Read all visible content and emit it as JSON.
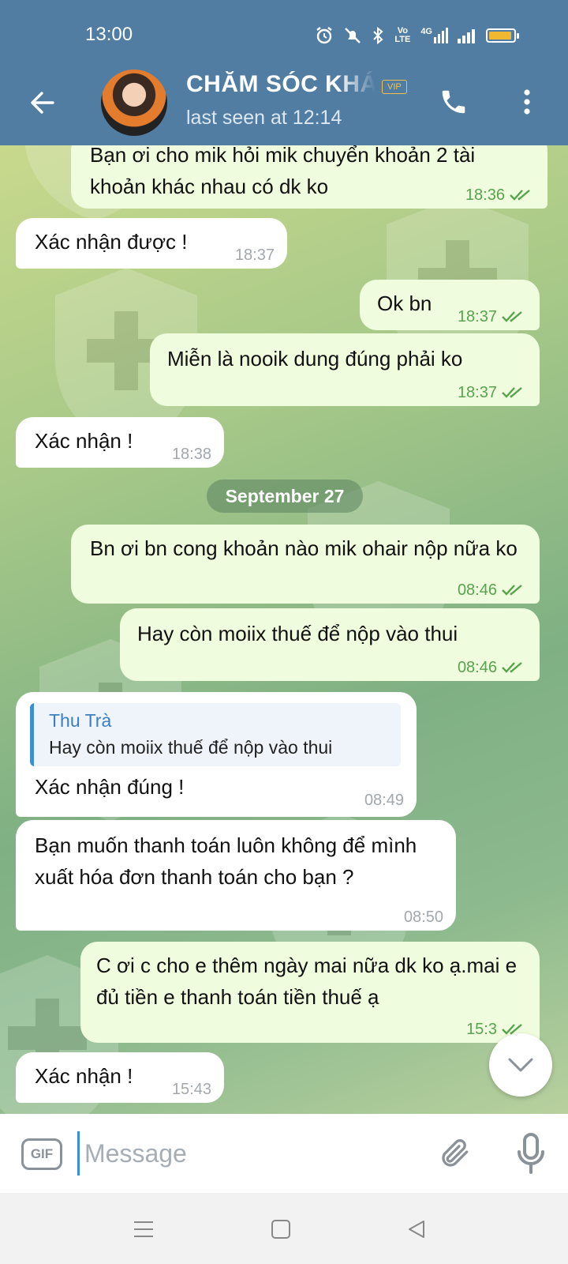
{
  "status_bar": {
    "time": "13:00",
    "volte": "Vo LTE",
    "network": "4G"
  },
  "header": {
    "title": "CHĂM SÓC KHÁCH HÀNG",
    "badge": "VIP",
    "subtitle": "last seen at 12:14"
  },
  "messages": [
    {
      "direction": "out",
      "text": "Bạn ơi cho mik hỏi mik chuyển khoản 2 tài khoản khác nhau có dk ko",
      "time": "18:36",
      "read": true
    },
    {
      "direction": "in",
      "text": "Xác nhận được !",
      "time": "18:37"
    },
    {
      "direction": "out",
      "text": "Ok bn",
      "time": "18:37",
      "read": true
    },
    {
      "direction": "out",
      "text": "Miễn là nooik dung đúng phải ko",
      "time": "18:37",
      "read": true
    },
    {
      "direction": "in",
      "text": "Xác nhận !",
      "time": "18:38"
    },
    {
      "direction": "out",
      "text": "Bn ơi bn cong khoản nào mik ohair nộp nữa ko",
      "time": "08:46",
      "read": true
    },
    {
      "direction": "out",
      "text": "Hay còn moiix thuế để nộp vào thui",
      "time": "08:46",
      "read": true
    },
    {
      "direction": "in",
      "text": "Xác nhận đúng !",
      "time": "08:49",
      "reply_to": {
        "name": "Thu Trà",
        "text": "Hay còn moiix thuế để nộp vào thui"
      }
    },
    {
      "direction": "in",
      "text": "Bạn muốn thanh toán luôn không để mình xuất hóa đơn thanh toán cho bạn ?",
      "time": "08:50"
    },
    {
      "direction": "out",
      "text": "C ơi c cho e thêm ngày mai nữa dk ko ạ.mai e đủ tiền e thanh toán tiền thuế ạ",
      "time": "15:3",
      "read": true
    },
    {
      "direction": "in",
      "text": "Xác nhận !",
      "time": "15:43"
    }
  ],
  "date_divider": "September 27",
  "input": {
    "placeholder": "Message",
    "gif_label": "GIF"
  },
  "colors": {
    "header": "#527da3",
    "outgoing_bubble": "#effdde",
    "incoming_bubble": "#ffffff",
    "accent": "#3b8fd2",
    "tick_green": "#58a34d"
  },
  "icons": {
    "back": "arrow-left-icon",
    "call": "phone-icon",
    "menu": "more-vertical-icon",
    "attach": "paperclip-icon",
    "mic": "microphone-icon",
    "scroll": "chevron-down-icon"
  }
}
